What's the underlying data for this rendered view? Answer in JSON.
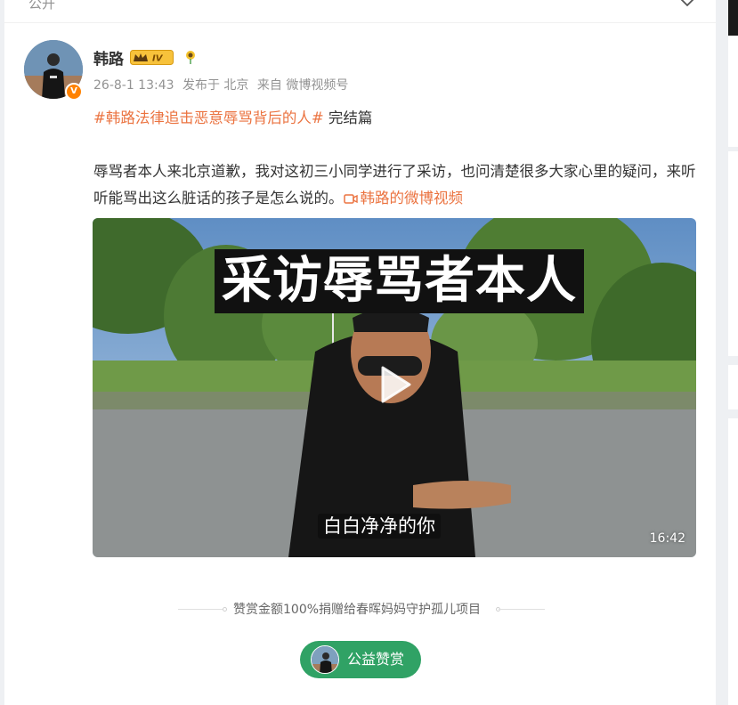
{
  "header": {
    "visibility": "公开",
    "dropdown_icon": "chevron-down-icon"
  },
  "author": {
    "name": "韩路",
    "level_badge": "IV",
    "verified_mark": "V",
    "post_time": "26-8-1 13:43",
    "location": "发布于 北京",
    "source": "来自 微博视频号"
  },
  "post": {
    "hashtag": "#韩路法律追击恶意辱骂背后的人#",
    "title_suffix": " 完结篇",
    "body": "辱骂者本人来北京道歉，我对这初三小同学进行了采访，也问清楚很多大家心里的疑问，来听听能骂出这么脏话的孩子是怎么说的。",
    "video_link_label": "韩路的微博视频"
  },
  "video": {
    "title_overlay": "采访辱骂者本人",
    "subtitle": "白白净净的你",
    "duration": "16:42"
  },
  "reward": {
    "note": "赞赏金额100%捐赠给春晖妈妈守护孤儿项目",
    "button_label": "公益赞赏"
  },
  "colors": {
    "link": "#eb7340",
    "reward_button": "#30a265",
    "verified": "#ff8200"
  }
}
